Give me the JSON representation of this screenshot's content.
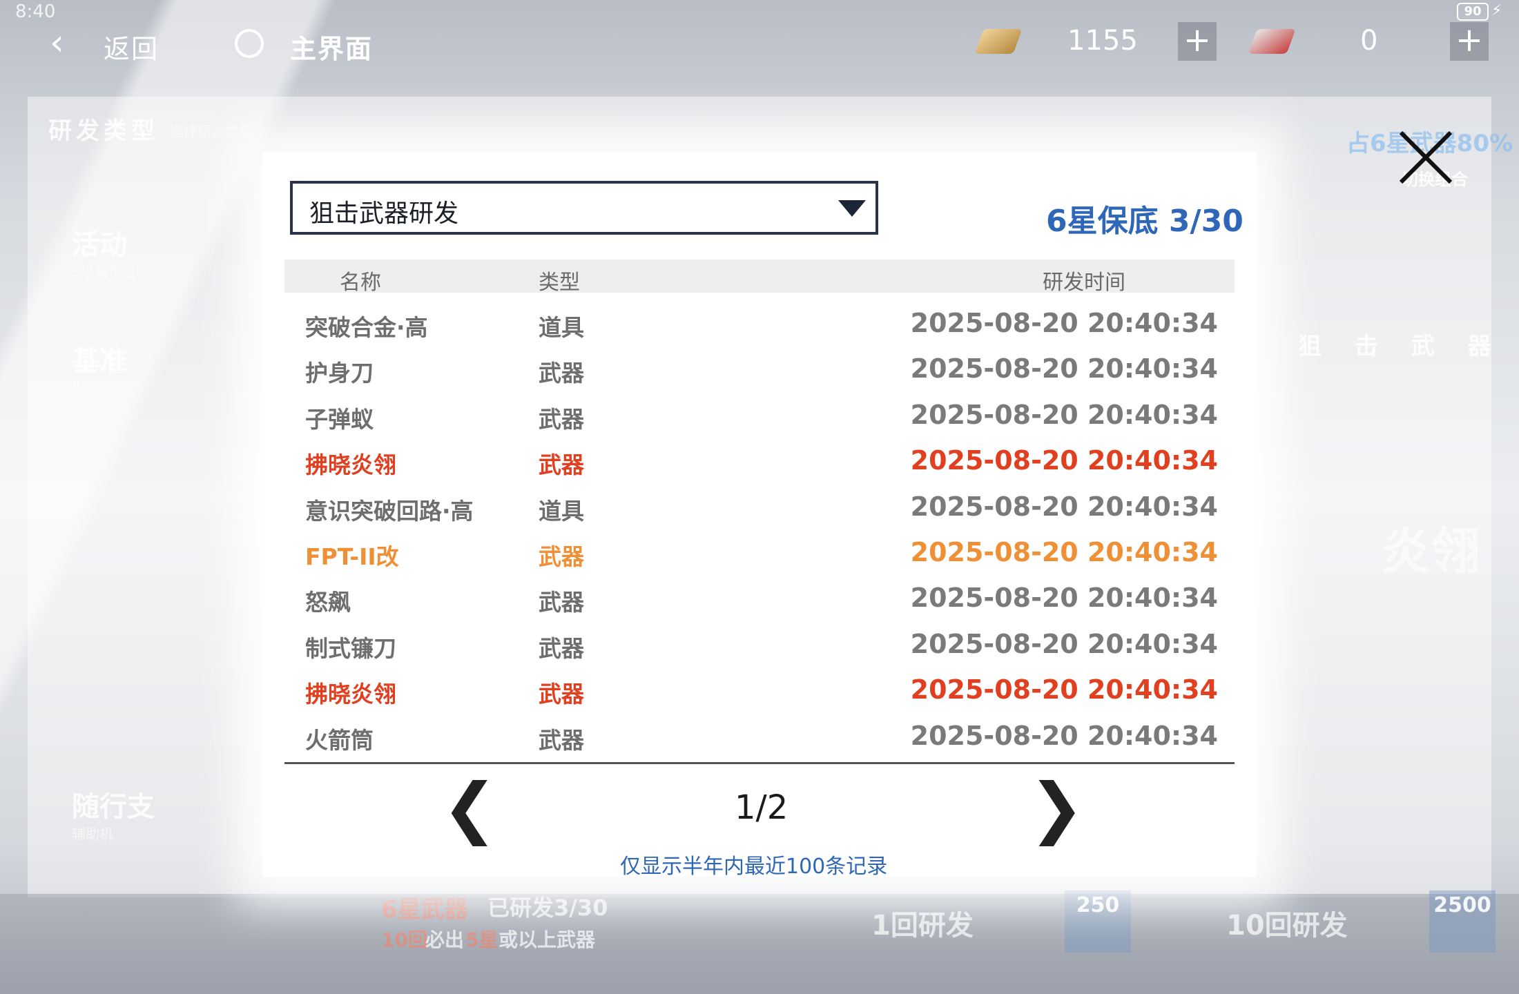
{
  "status_bar": {
    "time": "8:40",
    "battery": "90"
  },
  "top_nav": {
    "back_label": "返回",
    "home_label": "主界面",
    "currencies": [
      {
        "icon": "gold-crystal-icon",
        "amount": "1155"
      },
      {
        "icon": "red-ticket-icon",
        "amount": "0"
      }
    ]
  },
  "background": {
    "section_title": "研发类型",
    "section_hint": "选择研发类型",
    "side_items": [
      {
        "label": "活动",
        "sub": "S级角色组装"
      },
      {
        "label": "基准",
        "sub": "All"
      },
      {
        "label": "随行支",
        "sub": "辅助机"
      }
    ],
    "right_text": "狙 击 武 器",
    "right_top": "占6星武器80%",
    "right_switch": "切换组合",
    "right_big": "炎翎",
    "bottom": {
      "pity_red": "6星武器",
      "pity_white": "已研发3/30",
      "guarantee_a": "10回",
      "guarantee_b": "必出",
      "guarantee_c": "5星",
      "guarantee_d": "或以上武器",
      "single_label": "1回研发",
      "single_cost": "250",
      "ten_label": "10回研发",
      "ten_cost": "2500"
    }
  },
  "modal": {
    "dropdown_value": "狙击武器研发",
    "pity_text": "6星保底 3/30",
    "columns": {
      "name": "名称",
      "type": "类型",
      "time": "研发时间"
    },
    "rows": [
      {
        "name": "突破合金·高",
        "type": "道具",
        "time": "2025-08-20 20:40:34",
        "rarity": "normal"
      },
      {
        "name": "护身刀",
        "type": "武器",
        "time": "2025-08-20 20:40:34",
        "rarity": "normal"
      },
      {
        "name": "子弹蚁",
        "type": "武器",
        "time": "2025-08-20 20:40:34",
        "rarity": "normal"
      },
      {
        "name": "拂晓炎翎",
        "type": "武器",
        "time": "2025-08-20 20:40:34",
        "rarity": "red"
      },
      {
        "name": "意识突破回路·高",
        "type": "道具",
        "time": "2025-08-20 20:40:34",
        "rarity": "normal"
      },
      {
        "name": "FPT-II改",
        "type": "武器",
        "time": "2025-08-20 20:40:34",
        "rarity": "orange"
      },
      {
        "name": "怒飙",
        "type": "武器",
        "time": "2025-08-20 20:40:34",
        "rarity": "normal"
      },
      {
        "name": "制式镰刀",
        "type": "武器",
        "time": "2025-08-20 20:40:34",
        "rarity": "normal"
      },
      {
        "name": "拂晓炎翎",
        "type": "武器",
        "time": "2025-08-20 20:40:34",
        "rarity": "red"
      },
      {
        "name": "火箭筒",
        "type": "武器",
        "time": "2025-08-20 20:40:34",
        "rarity": "normal"
      }
    ],
    "pager": {
      "current": "1/2",
      "prev": "❮",
      "next": "❯"
    },
    "footer_note": "仅显示半年内最近100条记录"
  }
}
